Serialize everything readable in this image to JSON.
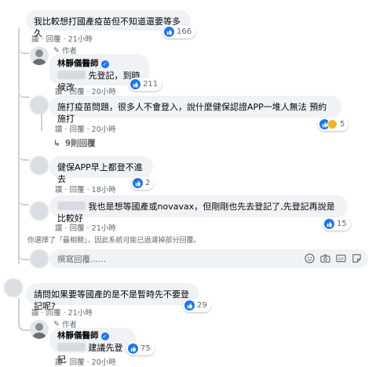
{
  "comments": [
    {
      "text": "我比較想打國產疫苗但不知道還要等多久",
      "reactions": "166",
      "actions": {
        "like": "讚",
        "reply": "回覆",
        "time": "21小時"
      },
      "replies": [
        {
          "author_tag": "作者",
          "author": "林靜儀醫師",
          "text_suffix": "先登記，到時候改",
          "reactions": "211",
          "actions": {
            "like": "讚",
            "reply": "回覆",
            "time": "20小時"
          }
        },
        {
          "text": "施打疫苗問題，很多人不會登入，說什麼健保認證APP一堆人無法 預約施打",
          "reactions": "5",
          "actions": {
            "like": "讚",
            "reply": "回覆",
            "time": "20小時"
          },
          "more_replies": "9則回覆"
        },
        {
          "text": "健保APP早上都登不進去",
          "reactions": "2",
          "actions": {
            "like": "讚",
            "reply": "回覆",
            "time": "18小時"
          }
        },
        {
          "text_suffix": "我也是想等國產或novavax，但剛剛也先去登記了,先登記再說是比較好",
          "reactions": "15",
          "actions": {
            "like": "讚",
            "reply": "回覆",
            "time": "21小時"
          }
        }
      ],
      "filter_notice": "你選擇了「最相關」，因此系統可能已過濾掉部分回覆。",
      "reply_placeholder": "撰寫回覆......"
    },
    {
      "text": "請問如果要等國產的是不是暫時先不要登記呢?",
      "reactions": "29",
      "actions": {
        "like": "讚",
        "reply": "回覆",
        "time": "21小時"
      },
      "replies": [
        {
          "author_tag": "作者",
          "author": "林靜儀醫師",
          "text": "建議先登記",
          "reactions": "75",
          "actions": {
            "like": "讚",
            "reply": "回覆",
            "time": "20小時"
          }
        }
      ]
    }
  ],
  "colors": {
    "bubble": "#f0f2f5",
    "like": "#1877f2",
    "meta": "#65676b",
    "thread": "#ced0d4"
  }
}
